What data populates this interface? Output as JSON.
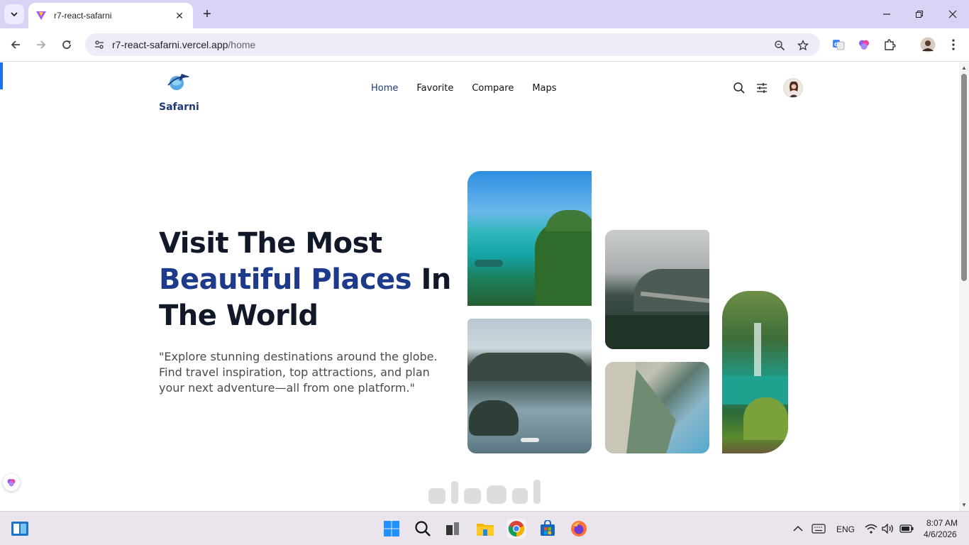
{
  "browser": {
    "tab_title": "r7-react-safarni",
    "tab_close": "✕",
    "new_tab": "+",
    "url_host": "r7-react-safarni.vercel.app",
    "url_path": "/home"
  },
  "site": {
    "logo_text": "Safarni",
    "nav": [
      "Home",
      "Favorite",
      "Compare",
      "Maps"
    ],
    "active_nav": "Home",
    "hero": {
      "title_line1": "Visit The Most",
      "title_accent": "Beautiful Places",
      "title_line2_rest": " In",
      "title_line3": "The World",
      "subtitle": "\"Explore stunning destinations around the globe. Find travel inspiration, top attractions, and plan your next adventure—all from one platform.\""
    },
    "accent_color": "#1e3a8a"
  },
  "taskbar": {
    "language": "ENG",
    "time": "8:07 AM",
    "date": "4/6/2026"
  }
}
